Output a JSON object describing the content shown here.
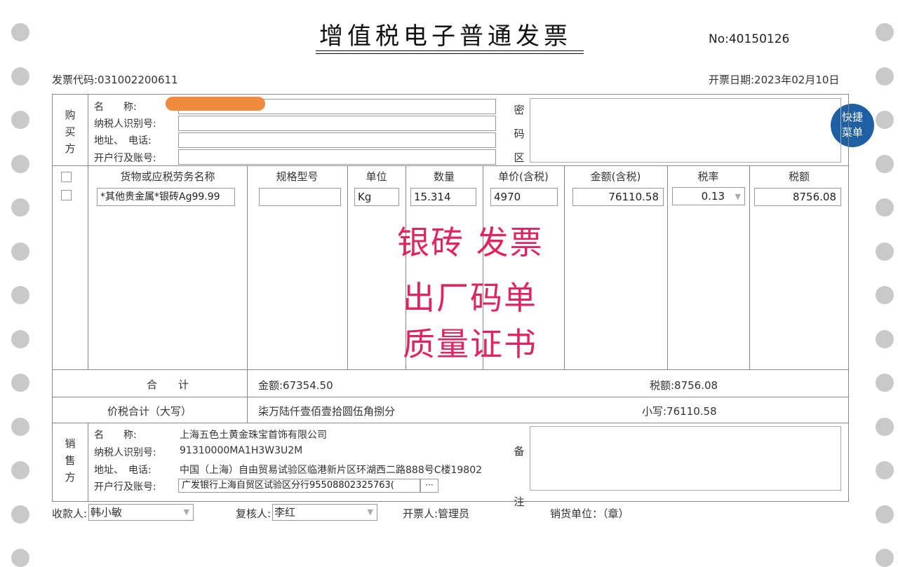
{
  "title": "增值税电子普通发票",
  "invoice_no": "No:40150126",
  "invoice_code": "发票代码:031002200611",
  "issue_date": "开票日期:2023年02月10日",
  "quick_menu": {
    "line1": "快捷",
    "line2": "菜单"
  },
  "buyer": {
    "section_label": "购买方",
    "name_label": "名　　称:",
    "tax_id_label": "纳税人识别号:",
    "address_label": "地址、　电话:",
    "bank_label": "开户行及账号:",
    "name_value": "",
    "redaction_color": "#f08a3c"
  },
  "password_area_label": "密码区",
  "columns": {
    "goods": "货物或应税劳务名称",
    "spec": "规格型号",
    "unit": "单位",
    "qty": "数量",
    "price": "单价(含税)",
    "amount": "金额(含税)",
    "rate": "税率",
    "tax": "税额"
  },
  "item": {
    "goods": "*其他贵金属*银砖Ag99.99",
    "spec": "",
    "unit": "Kg",
    "qty": "15.314",
    "price": "4970",
    "amount": "76110.58",
    "rate": "0.13",
    "tax": "8756.08"
  },
  "overlay_text": {
    "line1": "银砖 发票",
    "line2": "出厂码单",
    "line3": "质量证书",
    "color": "#e0245e"
  },
  "totals": {
    "label": "合　　计",
    "amount": "金额:67354.50",
    "tax": "税额:8756.08",
    "sum_label": "价税合计（大写）",
    "sum_words": "柒万陆仟壹佰壹拾圆伍角捌分",
    "sum_small": "小写:76110.58"
  },
  "seller": {
    "section_label": "销售方",
    "name_label": "名　　称:",
    "tax_id_label": "纳税人识别号:",
    "address_label": "地址、　电话:",
    "bank_label": "开户行及账号:",
    "name_value": "上海五色土黄金珠宝首饰有限公司",
    "tax_id_value": "91310000MA1H3W3U2M",
    "address_value": "中国（上海）自由贸易试验区临港新片区环湖西二路888号C楼19802",
    "bank_value": "广发银行上海自贸区试验区分行95508802325763(",
    "more_button": "···"
  },
  "remarks_label": "备注",
  "footer": {
    "payee_label": "收款人:",
    "payee_value": "韩小敏",
    "reviewer_label": "复核人:",
    "reviewer_value": "李红",
    "drawer": "开票人:管理员",
    "seller_unit": "销货单位：（章）"
  },
  "accent_color": "#1f5fa3"
}
